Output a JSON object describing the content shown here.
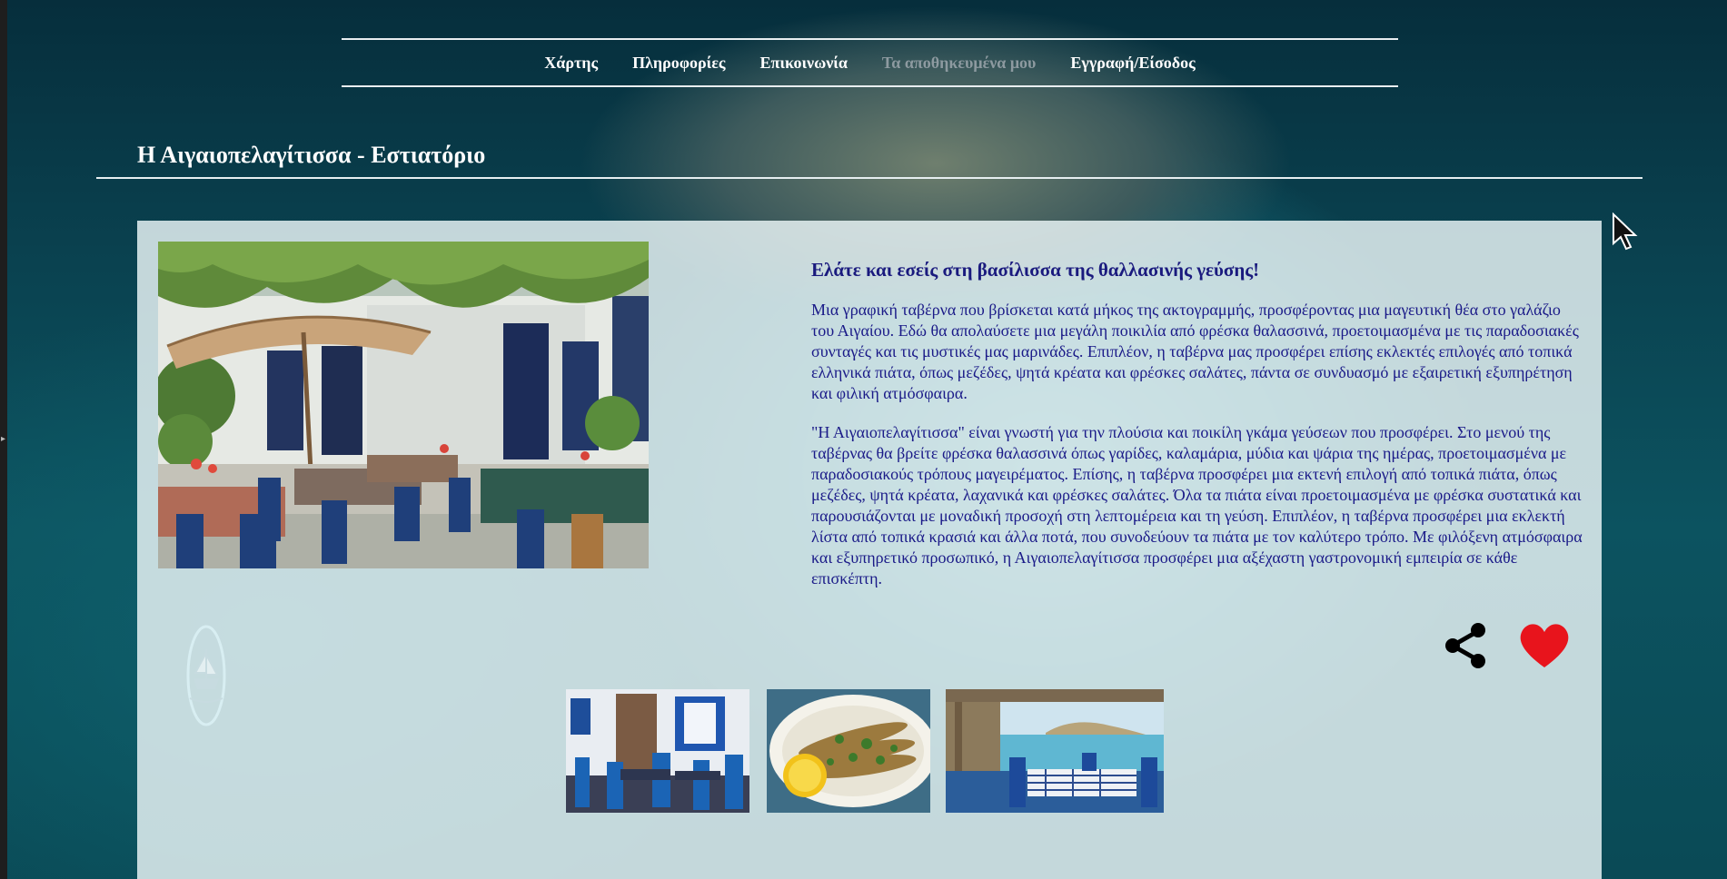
{
  "nav": {
    "items": [
      {
        "label": "Χάρτης",
        "active": false
      },
      {
        "label": "Πληροφορίες",
        "active": false
      },
      {
        "label": "Επικοινωνία",
        "active": false
      },
      {
        "label": "Τα αποθηκευμένα μου",
        "active": true
      },
      {
        "label": "Εγγραφή/Είσοδος",
        "active": false
      }
    ]
  },
  "page": {
    "title": "Η Αιγαιοπελαγίτισσα - Εστιατόριο"
  },
  "content": {
    "heading": "Ελάτε και εσείς στη βασίλισσα της θαλλασινής γεύσης!",
    "paragraph1": "Μια γραφική ταβέρνα που βρίσκεται κατά μήκος της ακτογραμμής, προσφέροντας μια μαγευτική θέα στο γαλάζιο του Αιγαίου. Εδώ θα απολαύσετε μια μεγάλη ποικιλία από φρέσκα θαλασσινά, προετοιμασμένα με τις παραδοσιακές συνταγές και τις μυστικές μας μαρινάδες. Επιπλέον, η ταβέρνα μας προσφέρει επίσης εκλεκτές επιλογές από τοπικά ελληνικά πιάτα, όπως μεζέδες, ψητά κρέατα και φρέσκες σαλάτες, πάντα σε συνδυασμό με εξαιρετική εξυπηρέτηση και φιλική ατμόσφαιρα.",
    "paragraph2": "\"Η Αιγαιοπελαγίτισσα\" είναι γνωστή για την πλούσια και ποικίλη γκάμα γεύσεων που προσφέρει. Στο μενού της ταβέρνας θα βρείτε φρέσκα θαλασσινά όπως γαρίδες, καλαμάρια, μύδια και ψάρια της ημέρας, προετοιμασμένα με παραδοσιακούς τρόπους μαγειρέματος. Επίσης, η ταβέρνα προσφέρει μια εκτενή επιλογή από τοπικά πιάτα, όπως μεζέδες, ψητά κρέατα, λαχανικά και φρέσκες σαλάτες. Όλα τα πιάτα είναι προετοιμασμένα με φρέσκα συστατικά και παρουσιάζονται με μοναδική προσοχή στη λεπτομέρεια και τη γεύση. Επιπλέον, η ταβέρνα προσφέρει μια εκλεκτή λίστα από τοπικά κρασιά και άλλα ποτά, που συνοδεύουν τα πιάτα με τον καλύτερο τρόπο. Με φιλόξενη ατμόσφαιρα και εξυπηρετικό προσωπικό, η Αιγαιοπελαγίτισσα προσφέρει μια αξέχαστη γαστρονομική εμπειρία σε κάθε επισκέπτη."
  },
  "actions": {
    "share_icon": "share-icon",
    "heart_icon": "heart-icon",
    "heart_color": "#e8141c"
  },
  "gallery": {
    "thumbnails": [
      "interior-dining-room",
      "grilled-sardines-plate",
      "seaside-terrace-view"
    ]
  },
  "colors": {
    "text_navy": "#1a1a88",
    "nav_active": "#8d9aa0",
    "panel_bg": "#eaf5f7"
  }
}
